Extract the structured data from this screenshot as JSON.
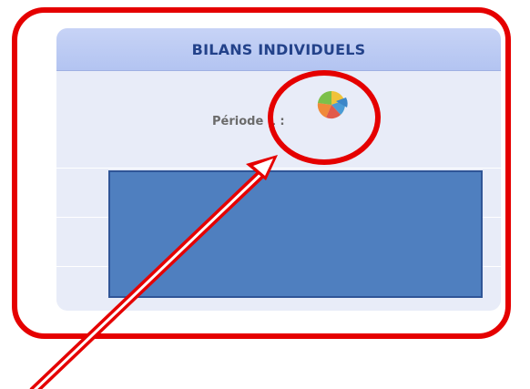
{
  "panel": {
    "title": "BILANS INDIVIDUELS",
    "period_label": "Période 1 :",
    "period_icon": "pie-chart-icon"
  },
  "annotations": {
    "highlight_color": "#e50000",
    "redaction_color": "#4f7fbf"
  }
}
